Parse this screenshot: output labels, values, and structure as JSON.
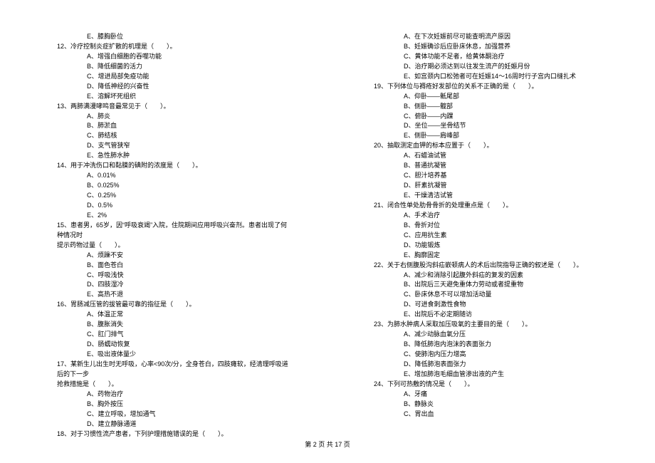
{
  "left": {
    "optE_11": "E、膝胸卧位",
    "q12": "12、冷疗控制炎症扩散的机理是（　　）。",
    "q12_A": "A、增强白细胞的吞噬功能",
    "q12_B": "B、降低细菌的活力",
    "q12_C": "C、增进局部免疫功能",
    "q12_D": "D、降低神经的兴奋性",
    "q12_E": "E、溶解坏死组织",
    "q13": "13、两肺满漫哮鸣音最常见于（　　）。",
    "q13_A": "A、肺炎",
    "q13_B": "B、肺淤血",
    "q13_C": "C、肺结核",
    "q13_D": "D、支气管狭窄",
    "q13_E": "E、急性肺水肿",
    "q14": "14、用于冲洗伤口和黏膜的碘附的浓度是（　　）。",
    "q14_A": "A、0.01%",
    "q14_B": "B、0.025%",
    "q14_C": "C、0.25%",
    "q14_D": "D、0.5%",
    "q14_E": "E、2%",
    "q15_l1": "15、患者男，65岁，因“呼吸衰竭”入院，住院期间应用呼吸兴奋剂。患者出现了何种情况时",
    "q15_l2": "提示药物过量（　　）。",
    "q15_A": "A、烦躁不安",
    "q15_B": "B、面色苍白",
    "q15_C": "C、呼吸浅快",
    "q15_D": "D、四肢湿冷",
    "q15_E": "E、高热不退",
    "q16": "16、胃肠减压管的拔管最可靠的指征是（　　）。",
    "q16_A": "A、体温正常",
    "q16_B": "B、腹胀消失",
    "q16_C": "C、肛门排气",
    "q16_D": "D、肠蠕动恢复",
    "q16_E": "E、吸出液体量少",
    "q17_l1": "17、某新生儿出生时无呼吸，心率<90次/分，全身苍白，四肢瘫软，经清理呼吸道后的下一步",
    "q17_l2": "抢救措施是（　　）。",
    "q17_A": "A、药物治疗",
    "q17_B": "B、胸外按压",
    "q17_C": "C、建立呼吸，增加通气",
    "q17_D": "D、建立静脉通道",
    "q18": "18、对于习惯性流产患者，下列护理措施错误的是（　　）。"
  },
  "right": {
    "q18_A": "A、在下次妊娠前尽可能查明流产原因",
    "q18_B": "B、妊娠确诊后应卧床休息，加强营养",
    "q18_C": "C、黄体功能不足者，给黄体酮治疗",
    "q18_D": "D、治疗期必须达到以往发生流产的妊娠月份",
    "q18_E": "E、如宫颈内口松弛者可在妊娠14～16周时行子宫内口缝扎术",
    "q19": "19、下列体位与褥疮好发部位的关系不正确的是（　　）。",
    "q19_A": "A、仰卧——骶尾部",
    "q19_B": "B、侧卧——髋部",
    "q19_C": "C、俯卧——内踝",
    "q19_D": "D、坐位——坐骨结节",
    "q19_E": "E、侧卧——肩峰部",
    "q20": "20、抽取测定血钾的标本应置于（　　）。",
    "q20_A": "A、石蜡油试管",
    "q20_B": "B、普通抗凝管",
    "q20_C": "C、胆汁培养基",
    "q20_D": "D、肝素抗凝管",
    "q20_E": "E、干燥清洁试管",
    "q21": "21、闭合性单处肋骨骨折的处理重点是（　　）。",
    "q21_A": "A、手术治疗",
    "q21_B": "B、骨折对位",
    "q21_C": "C、应用抗生素",
    "q21_D": "D、功能锻炼",
    "q21_E": "E、胸廓固定",
    "q22": "22、关于右侧腹股沟斜疝嵌顿病人的术后出院指导正确的叙述是（　　）。",
    "q22_A": "A、减少和消除引起腹外斜疝的复发的因素",
    "q22_B": "B、出院后三天避免重体力劳动或者提重物",
    "q22_C": "C、卧床休息不可以增加活动量",
    "q22_D": "D、可进食刺激性食物",
    "q22_E": "E、出院后不必定期随访",
    "q23": "23、为肺水肿病人采取加压吸氧的主要目的是（　　）。",
    "q23_A": "A、减少动脉血氧分压",
    "q23_B": "B、降低肺泡内泡沫的表面张力",
    "q23_C": "C、使肺泡内压力增高",
    "q23_D": "D、降低肺泡表面张力",
    "q23_E": "E、增加肺泡毛细血管渗出液的产生",
    "q24": "24、下列可热敷的情况是（　　）。",
    "q24_A": "A、牙痛",
    "q24_B": "B、静脉炎",
    "q24_C": "C、胃出血"
  },
  "footer": "第 2 页 共 17 页"
}
